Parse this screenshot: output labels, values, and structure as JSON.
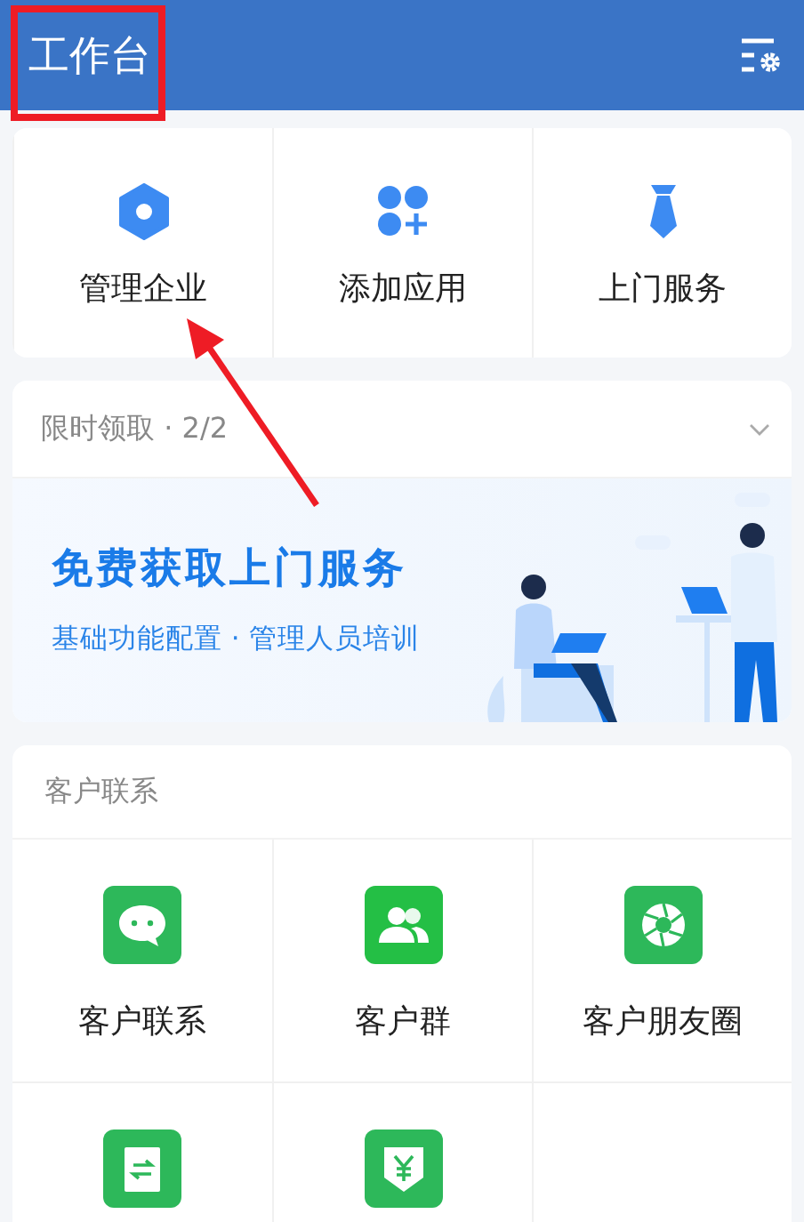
{
  "header": {
    "title": "工作台"
  },
  "quick_actions": [
    {
      "label": "管理企业"
    },
    {
      "label": "添加应用"
    },
    {
      "label": "上门服务"
    }
  ],
  "promo": {
    "header": "限时领取 · 2/2",
    "title": "免费获取上门服务",
    "subtitle": "基础功能配置 · 管理人员培训"
  },
  "customer_section": {
    "title": "客户联系",
    "items": [
      {
        "kind": "labeled",
        "label": "客户联系"
      },
      {
        "kind": "labeled",
        "label": "客户群"
      },
      {
        "kind": "labeled",
        "label": "客户朋友圈"
      },
      {
        "kind": "icon-only"
      },
      {
        "kind": "icon-only"
      }
    ]
  },
  "annotations": {
    "highlight_box": true,
    "arrow": true
  }
}
